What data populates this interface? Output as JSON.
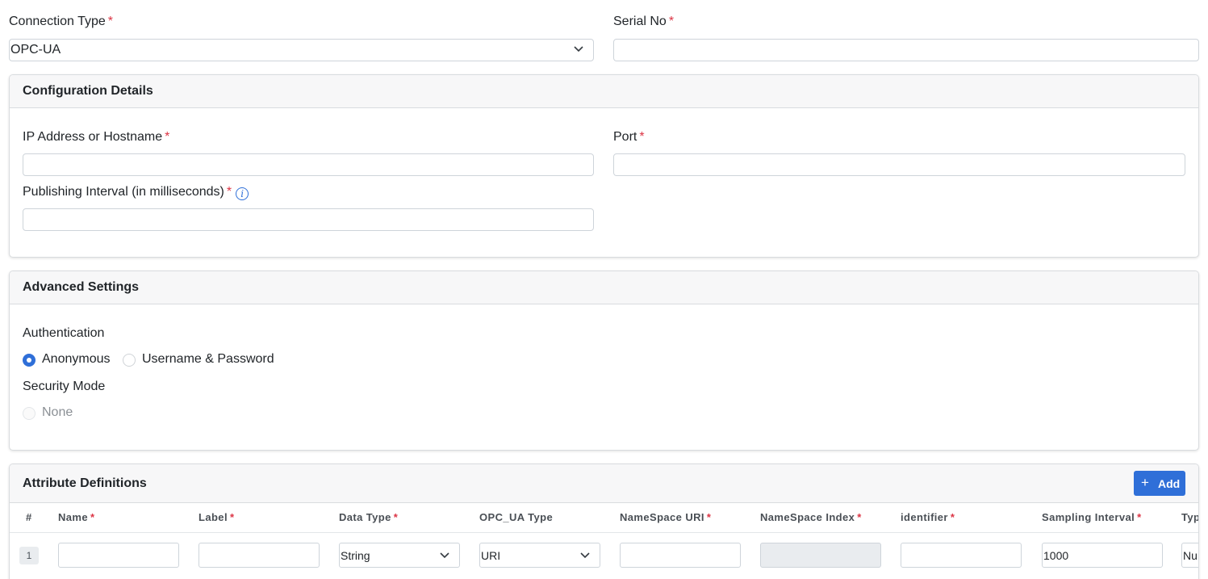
{
  "connection_type": {
    "label": "Connection Type",
    "required": "*",
    "value": "OPC-UA"
  },
  "serial_no": {
    "label": "Serial No",
    "required": "*",
    "value": ""
  },
  "configuration": {
    "title": "Configuration Details",
    "ip": {
      "label": "IP Address or Hostname",
      "required": "*",
      "value": ""
    },
    "port": {
      "label": "Port",
      "required": "*",
      "value": ""
    },
    "publishing_interval": {
      "label": "Publishing Interval (in milliseconds)",
      "required": "*",
      "value": "",
      "info_icon": "i"
    }
  },
  "advanced": {
    "title": "Advanced Settings",
    "authentication_label": "Authentication",
    "auth_options": [
      {
        "label": "Anonymous",
        "selected": true
      },
      {
        "label": "Username & Password",
        "selected": false
      }
    ],
    "security_mode_label": "Security Mode",
    "security_options": [
      {
        "label": "None",
        "selected": false,
        "disabled": true
      }
    ]
  },
  "attributes": {
    "title": "Attribute Definitions",
    "add_label": "Add",
    "add_icon": "+",
    "columns": [
      {
        "label": "#",
        "required": ""
      },
      {
        "label": "Name",
        "required": "*"
      },
      {
        "label": "Label",
        "required": "*"
      },
      {
        "label": "Data Type",
        "required": "*"
      },
      {
        "label": "OPC_UA Type",
        "required": ""
      },
      {
        "label": "NameSpace URI",
        "required": "*"
      },
      {
        "label": "NameSpace Index",
        "required": "*"
      },
      {
        "label": "identifier",
        "required": "*"
      },
      {
        "label": "Sampling Interval",
        "required": "*"
      },
      {
        "label": "Typ",
        "required": ""
      }
    ],
    "rows": [
      {
        "index": "1",
        "name": "",
        "label": "",
        "data_type": "String",
        "opc_ua_type": "URI",
        "namespace_uri": "",
        "namespace_index": "",
        "identifier": "",
        "sampling_interval": "1000",
        "type": "Nu"
      }
    ]
  },
  "icons": {
    "chevron": "chevron-down-icon",
    "info": "info-icon",
    "plus": "plus-icon"
  },
  "colors": {
    "accent": "#2f6fd8",
    "required": "#dc3545",
    "header_bg": "#f7f7f8"
  }
}
